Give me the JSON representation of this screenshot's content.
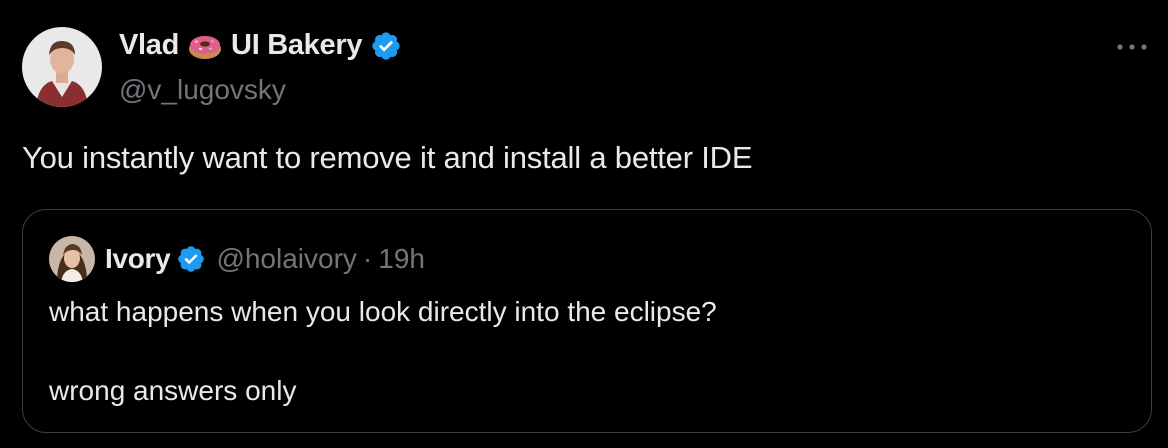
{
  "author": {
    "name": "Vlad",
    "emoji_icon": "donut-icon",
    "name_suffix": "UI Bakery",
    "verified": true,
    "handle": "@v_lugovsky"
  },
  "tweet": {
    "text": "You instantly want to remove it and install a better IDE"
  },
  "more_label": "More",
  "quoted": {
    "name": "Ivory",
    "verified": true,
    "handle": "@holaivory",
    "separator": "·",
    "time": "19h",
    "lines": [
      "what happens when you look directly into the eclipse?",
      "wrong answers only"
    ]
  },
  "colors": {
    "background": "#000000",
    "text": "#e7e9ea",
    "secondary": "#71767b",
    "verified_blue": "#1d9bf0",
    "border": "#3b3f43"
  }
}
